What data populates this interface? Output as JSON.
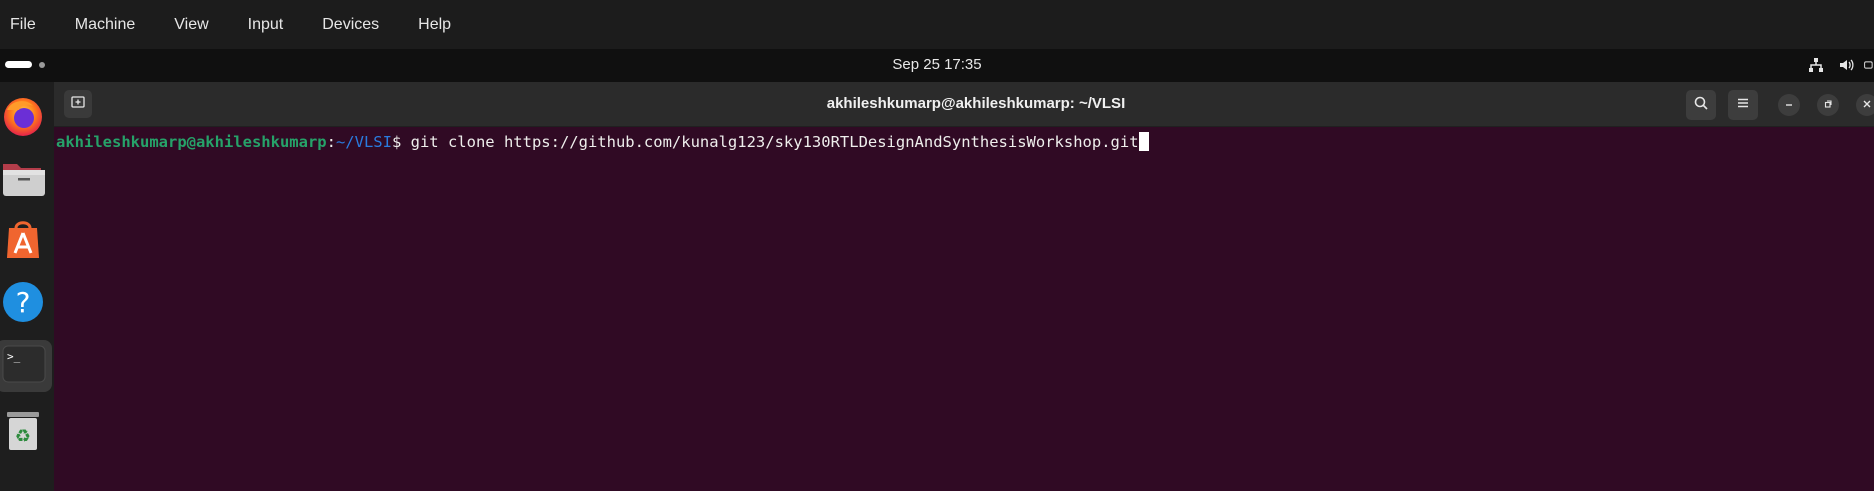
{
  "host_menu": {
    "items": [
      "File",
      "Machine",
      "View",
      "Input",
      "Devices",
      "Help"
    ]
  },
  "top_panel": {
    "clock": "Sep 25  17:35"
  },
  "dock": {
    "apps": [
      "firefox-icon",
      "files-icon",
      "app-center-icon",
      "help-icon",
      "terminal-icon",
      "trash-icon"
    ]
  },
  "terminal": {
    "title": "akhileshkumarp@akhileshkumarp: ~/VLSI",
    "prompt_user": "akhileshkumarp@akhileshkumarp",
    "prompt_sep": ":",
    "prompt_path": "~/VLSI",
    "prompt_symbol": "$ ",
    "command": "git clone https://github.com/kunalg123/sky130RTLDesignAndSynthesisWorkshop.git"
  },
  "colors": {
    "terminal_bg": "#300a24",
    "prompt_user": "#26a269",
    "prompt_path": "#2a7bde"
  }
}
